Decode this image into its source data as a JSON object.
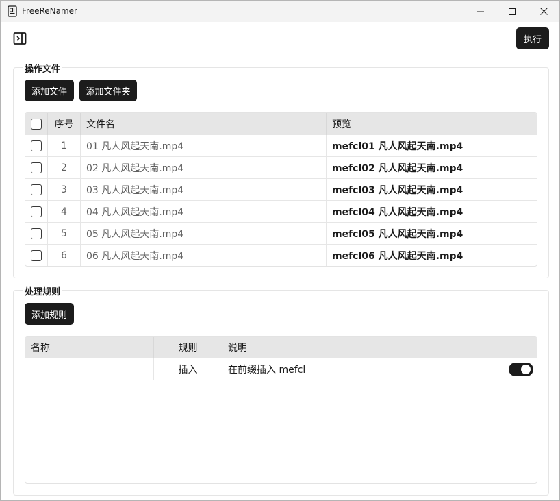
{
  "window": {
    "title": "FreeReNamer",
    "controls": [
      "minimize-icon",
      "maximize-icon",
      "close-icon"
    ]
  },
  "toolbar": {
    "sidebar_toggle_icon": "sidebar-toggle-icon",
    "run_label": "执行"
  },
  "files_section": {
    "title": "操作文件",
    "add_files_label": "添加文件",
    "add_folder_label": "添加文件夹",
    "columns": {
      "select": "",
      "index": "序号",
      "filename": "文件名",
      "preview": "预览"
    },
    "rows": [
      {
        "index": "1",
        "filename": "01 凡人风起天南.mp4",
        "preview": "mefcl01 凡人风起天南.mp4",
        "checked": false
      },
      {
        "index": "2",
        "filename": "02 凡人风起天南.mp4",
        "preview": "mefcl02 凡人风起天南.mp4",
        "checked": false
      },
      {
        "index": "3",
        "filename": "03 凡人风起天南.mp4",
        "preview": "mefcl03 凡人风起天南.mp4",
        "checked": false
      },
      {
        "index": "4",
        "filename": "04 凡人风起天南.mp4",
        "preview": "mefcl04 凡人风起天南.mp4",
        "checked": false
      },
      {
        "index": "5",
        "filename": "05 凡人风起天南.mp4",
        "preview": "mefcl05 凡人风起天南.mp4",
        "checked": false
      },
      {
        "index": "6",
        "filename": "06 凡人风起天南.mp4",
        "preview": "mefcl06 凡人风起天南.mp4",
        "checked": false
      }
    ]
  },
  "rules_section": {
    "title": "处理规则",
    "add_rule_label": "添加规则",
    "columns": {
      "name": "名称",
      "rule": "规则",
      "description": "说明",
      "enabled": ""
    },
    "rows": [
      {
        "name": "",
        "rule": "插入",
        "description": "在前缀插入 mefcl",
        "enabled": true
      }
    ]
  },
  "colors": {
    "accent": "#1c1c1c",
    "header_bg": "#e6e6e6",
    "titlebar_bg": "#f3f3f3"
  }
}
